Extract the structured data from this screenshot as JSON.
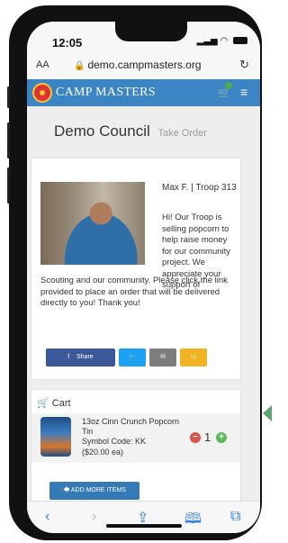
{
  "status_bar": {
    "time": "12:05"
  },
  "browser": {
    "text_size_label": "AA",
    "url": "demo.campmasters.org"
  },
  "navbar": {
    "brand": "CAMP MASTERS"
  },
  "page": {
    "council": "Demo Council",
    "subtitle": "Take Order"
  },
  "profile": {
    "name": "Max F. | Troop 313",
    "message_right": "Hi! Our Troop is selling popcorn to help raise money for our community project. We appreciate your support of",
    "message_bottom": "Scouting and our community. Please click the link provided to place an order that will be delivered directly to you! Thank you!"
  },
  "share": {
    "facebook_label": "Share"
  },
  "cart": {
    "title": "Cart",
    "item": {
      "name": "13oz Cinn Crunch Popcorn Tin",
      "symbol": "Symbol Code: KK",
      "price": "($20.00 ea)",
      "quantity": "1"
    },
    "add_more_label": "ADD MORE ITEMS"
  },
  "colors": {
    "navbar": "#3c85c4",
    "facebook": "#3b5998",
    "twitter": "#1da1f2",
    "email": "#7d7d7d",
    "sms": "#f0b323",
    "minus": "#d9534f",
    "plus": "#5cb85c",
    "add_more": "#337ab7"
  }
}
